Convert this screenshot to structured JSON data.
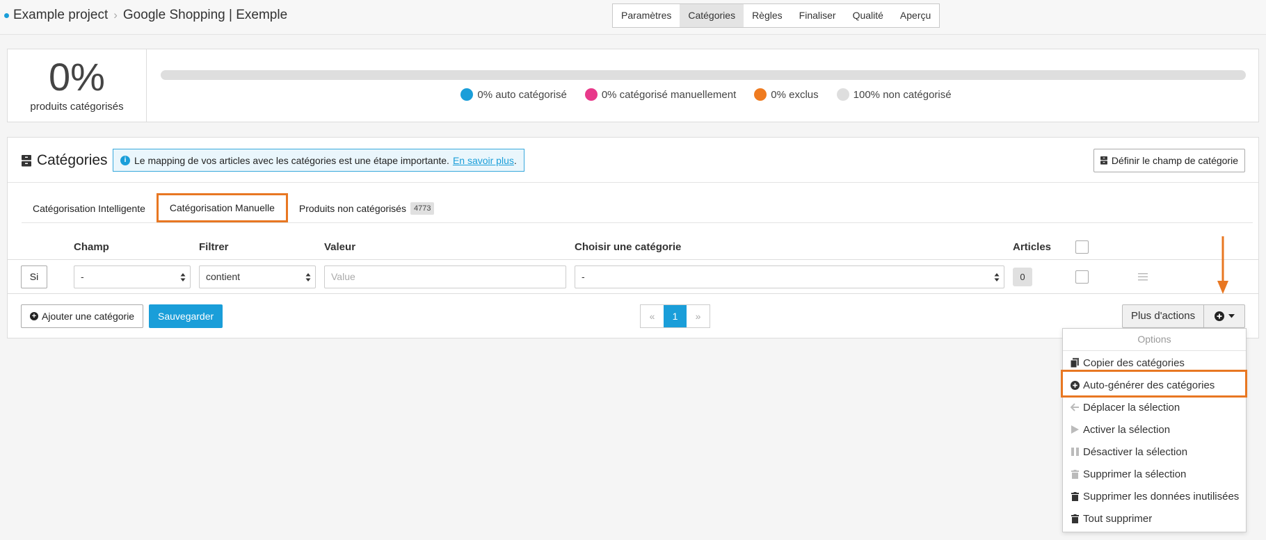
{
  "topbar": {
    "project": "Example project",
    "feed": "Google Shopping | Exemple",
    "steps": [
      "Paramètres",
      "Catégories",
      "Règles",
      "Finaliser",
      "Qualité",
      "Aperçu"
    ],
    "active_step": "Catégories"
  },
  "progress": {
    "percent": "0%",
    "label": "produits catégorisés",
    "fill_fraction": 0,
    "legend": [
      {
        "label": "0% auto catégorisé",
        "color": "#1a9ed9"
      },
      {
        "label": "0% catégorisé manuellement",
        "color": "#e8398a"
      },
      {
        "label": "0% exclus",
        "color": "#ef7b20"
      },
      {
        "label": "100% non catégorisé",
        "color": "#dedede"
      }
    ]
  },
  "categories": {
    "title": "Catégories",
    "info_text": "Le mapping de vos articles avec les catégories est une étape importante.",
    "info_link": "En savoir plus",
    "info_suffix": ".",
    "define_button": "Définir le champ de catégorie",
    "tabs": {
      "smart": "Catégorisation Intelligente",
      "manual": "Catégorisation Manuelle",
      "uncategorized": "Produits non catégorisés",
      "uncategorized_count": "4773"
    },
    "columns": {
      "field": "Champ",
      "filter": "Filtrer",
      "value": "Valeur",
      "category": "Choisir une catégorie",
      "articles": "Articles"
    },
    "row": {
      "condition": "Si",
      "field": "-",
      "filter": "contient",
      "value_placeholder": "Value",
      "category": "-",
      "articles": "0"
    },
    "add_button": "Ajouter une catégorie",
    "save_button": "Sauvegarder",
    "pager": {
      "prev": "«",
      "current": "1",
      "next": "»"
    },
    "more_actions": "Plus d'actions"
  },
  "dropdown": {
    "header": "Options",
    "items": [
      {
        "label": "Copier des catégories",
        "icon": "copy-icon"
      },
      {
        "label": "Auto-générer des catégories",
        "icon": "plus-circle-icon"
      },
      {
        "label": "Déplacer la sélection",
        "icon": "arrow-left-icon"
      },
      {
        "label": "Activer la sélection",
        "icon": "play-icon"
      },
      {
        "label": "Désactiver la sélection",
        "icon": "pause-icon"
      },
      {
        "label": "Supprimer la sélection",
        "icon": "trash-icon"
      },
      {
        "label": "Supprimer les données inutilisées",
        "icon": "trash-icon"
      },
      {
        "label": "Tout supprimer",
        "icon": "trash-icon"
      }
    ]
  },
  "colors": {
    "accent": "#1a9ed9",
    "highlight": "#e87722"
  }
}
